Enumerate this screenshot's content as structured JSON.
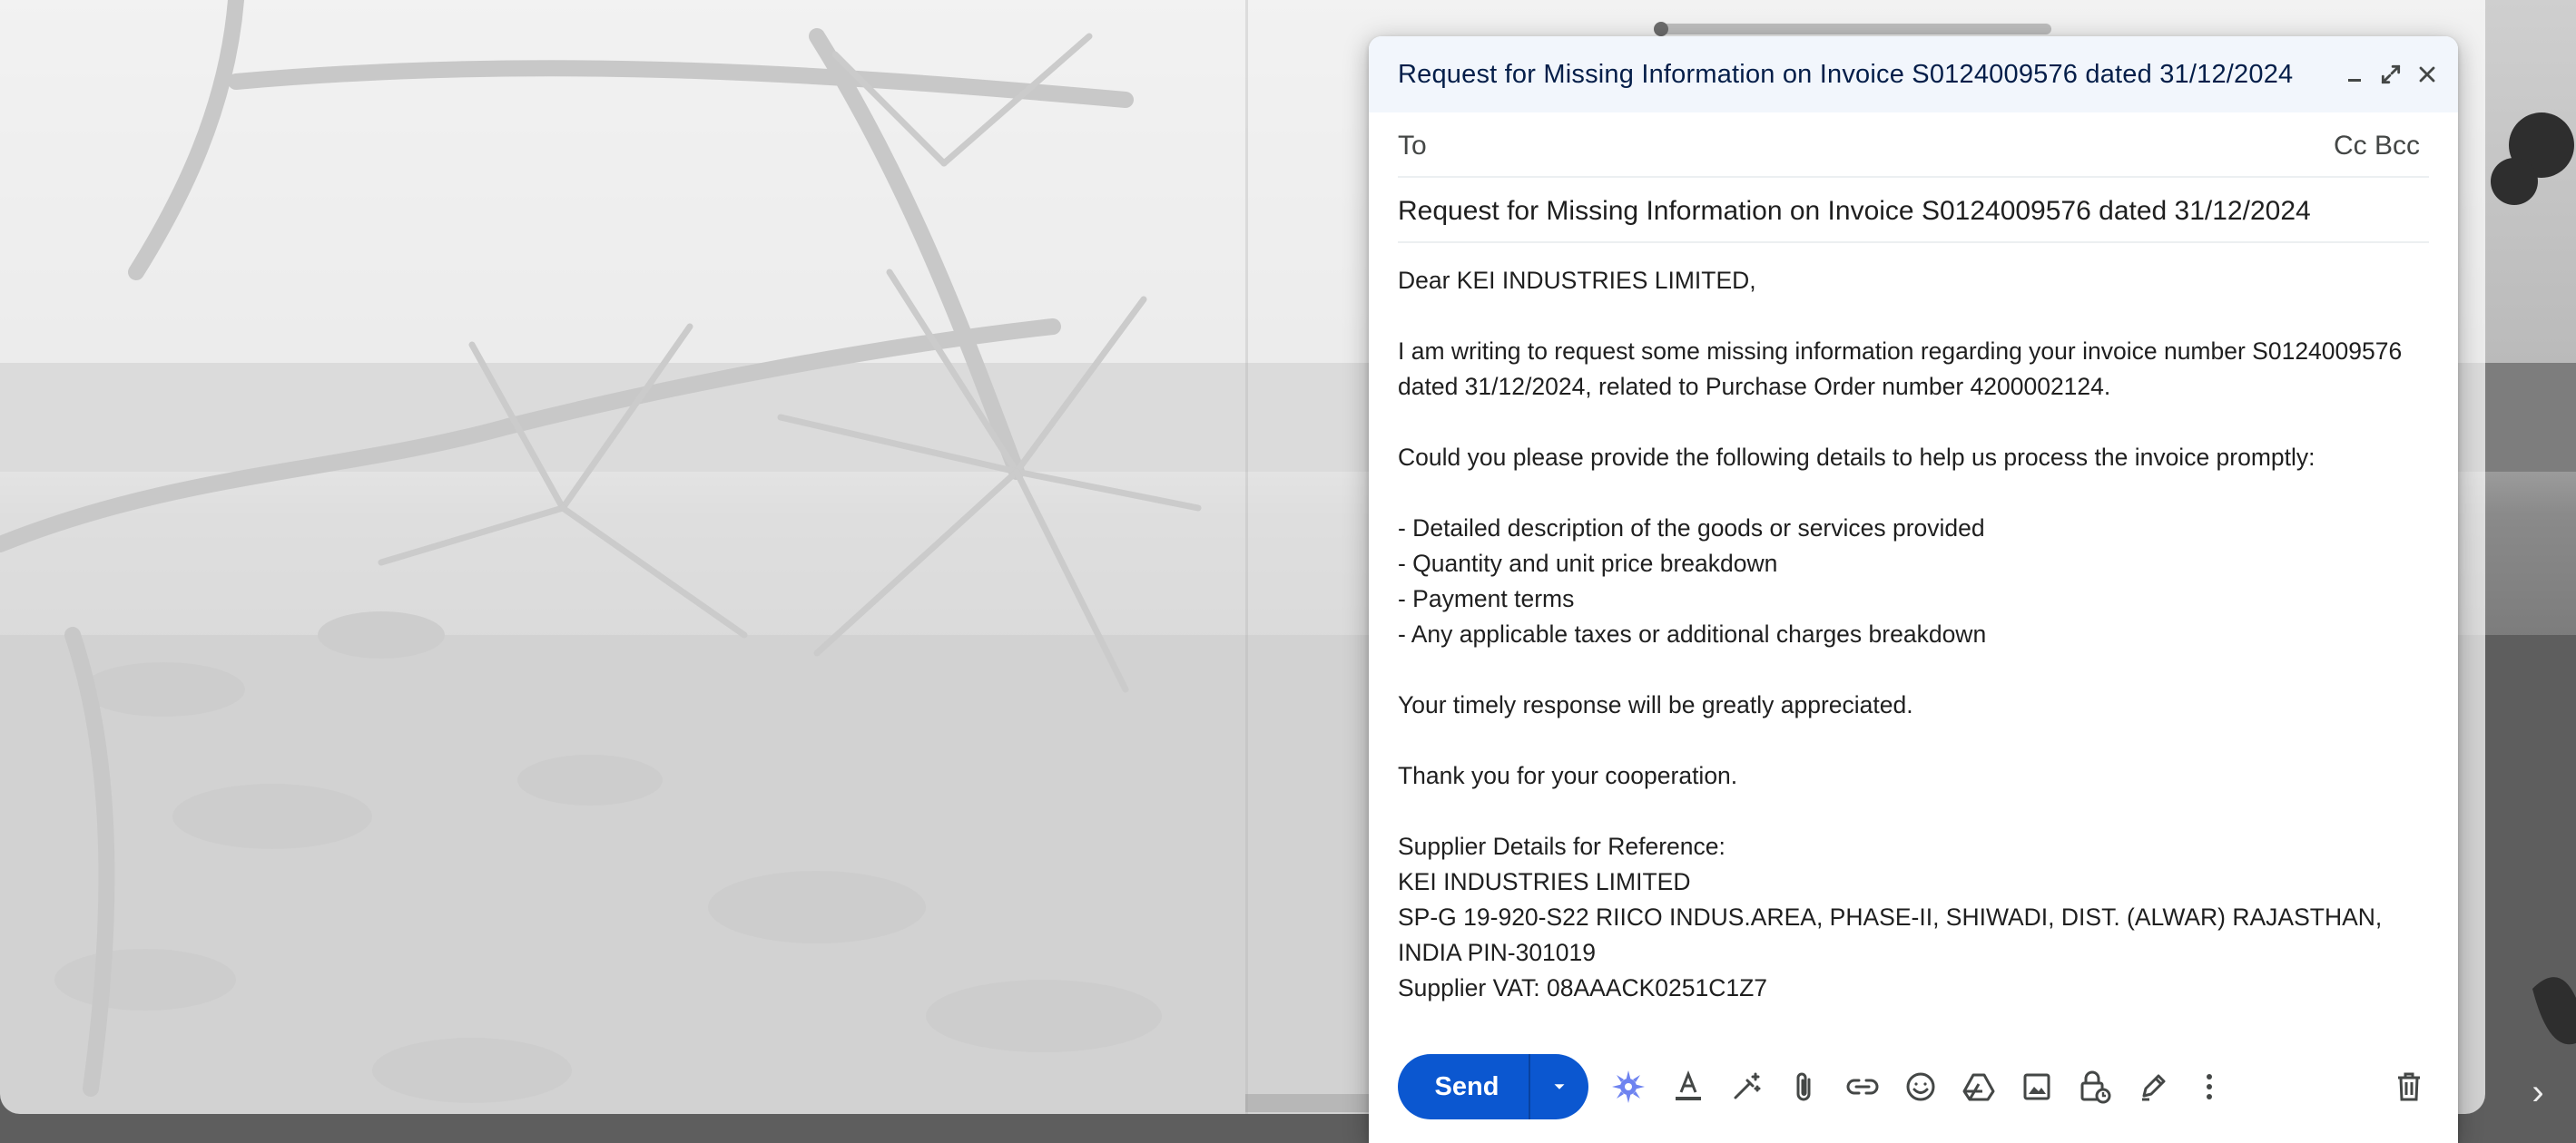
{
  "compose": {
    "window_title": "Request for Missing Information on Invoice S0124009576 dated 31/12/2024",
    "to_label": "To",
    "cc_bcc_label": "Cc Bcc",
    "subject": "Request for Missing Information on Invoice S0124009576 dated 31/12/2024",
    "body": {
      "greeting": "Dear KEI INDUSTRIES LIMITED,",
      "para1_line1": "I am writing to request some missing information regarding your invoice number S0124009576",
      "para1_line2": "dated 31/12/2024, related to Purchase Order number 4200002124.",
      "para2": "Could you please provide the following details to help us process the invoice promptly:",
      "list": [
        "- Detailed description of the goods or services provided",
        "- Quantity and unit price breakdown",
        "- Payment terms",
        "- Any applicable taxes or additional charges breakdown"
      ],
      "para3": "Your timely response will be greatly appreciated.",
      "para4": "Thank you for your cooperation.",
      "supplier_heading": "Supplier Details for Reference:",
      "supplier_name": "KEI INDUSTRIES LIMITED",
      "supplier_address_line1": "SP-G 19-920-S22 RIICO INDUS.AREA, PHASE-II, SHIWADI, DIST. (ALWAR) RAJASTHAN,",
      "supplier_address_line2": "INDIA PIN-301019",
      "supplier_vat": "Supplier VAT: 08AAACK0251C1Z7"
    },
    "header_icons": [
      "minimize-icon",
      "expand-icon",
      "close-icon"
    ],
    "toolbar": {
      "send_label": "Send",
      "icons": [
        "send-options-icon",
        "ai-sparkle-icon",
        "formatting-icon",
        "magic-pen-icon",
        "attach-icon",
        "link-icon",
        "emoji-icon",
        "drive-icon",
        "photo-icon",
        "confidential-mode-icon",
        "signature-icon",
        "more-options-icon",
        "discard-icon"
      ]
    }
  },
  "colors": {
    "send_button": "#0b57d0",
    "header_bg": "#f2f6fc",
    "title_text": "#041e49",
    "ai_sparkle": "#6e83f0"
  }
}
